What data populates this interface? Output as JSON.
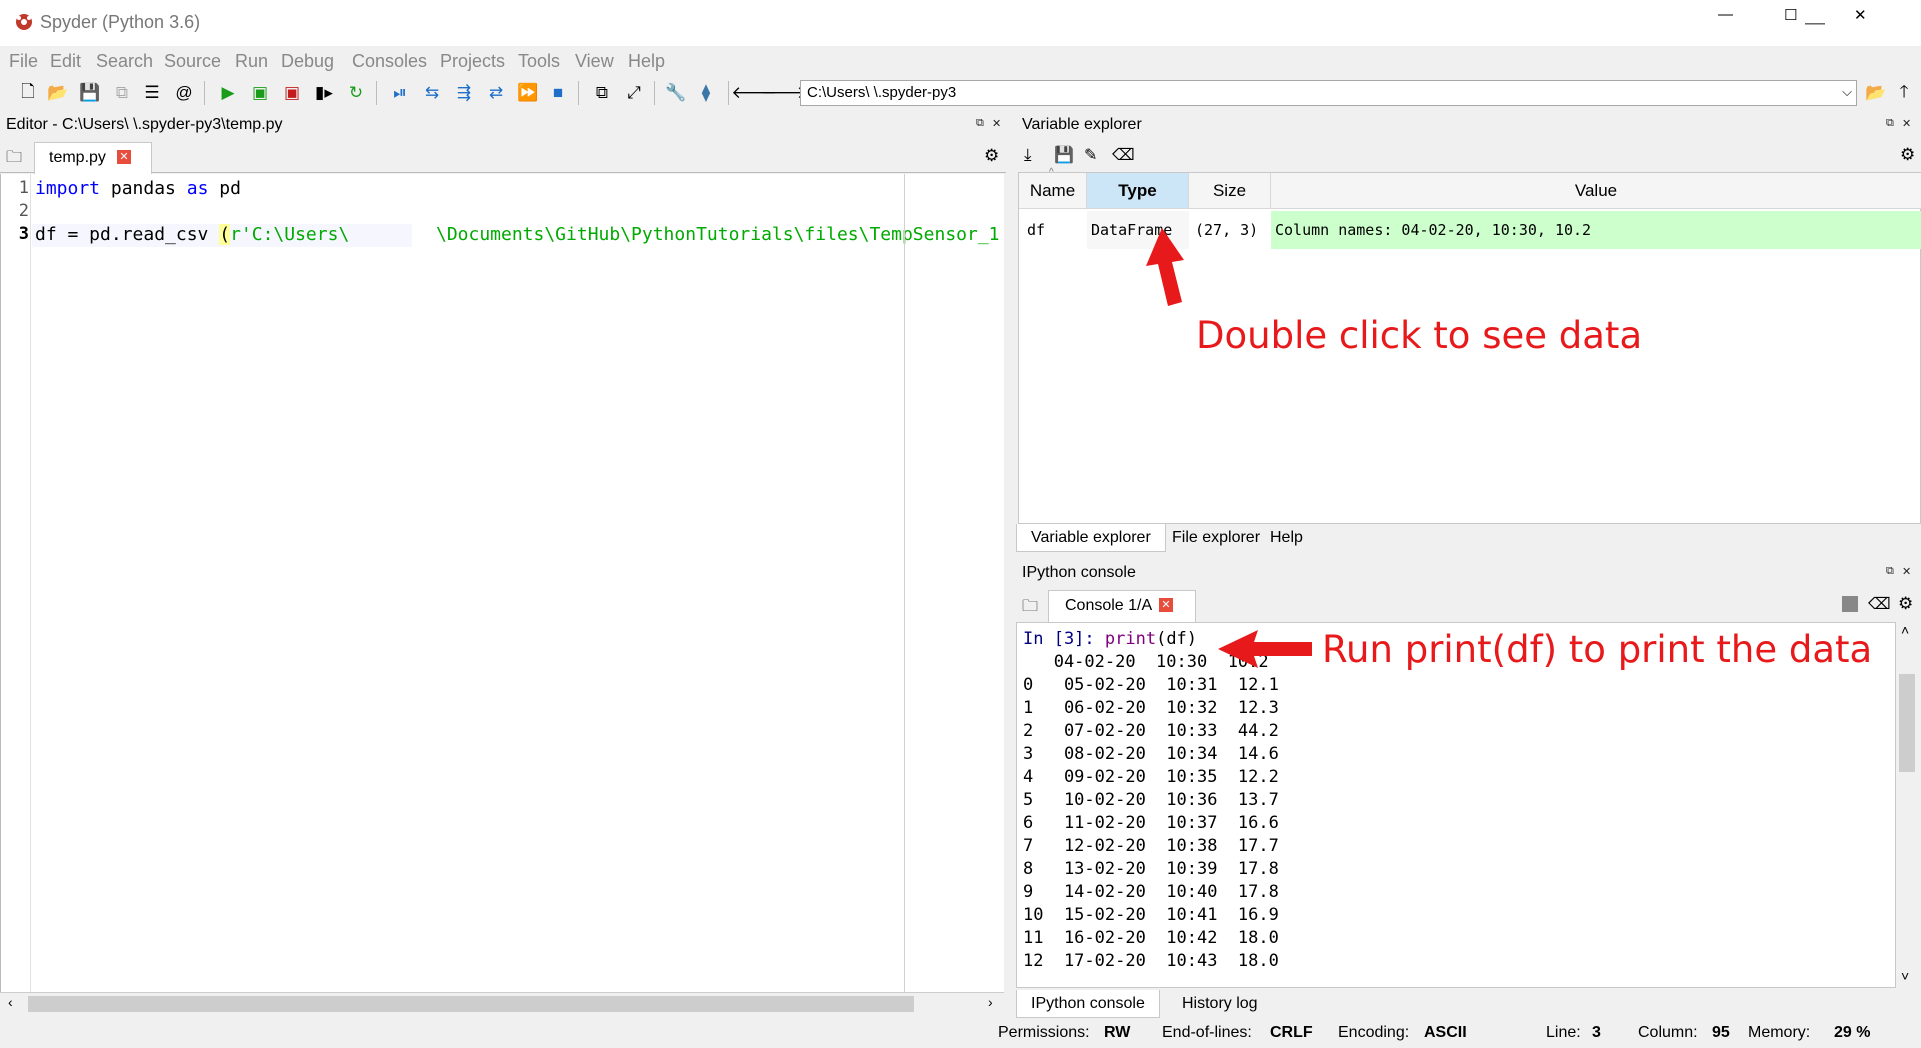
{
  "window": {
    "title": "Spyder (Python 3.6)",
    "minimize": "—",
    "maximize": "☐",
    "close": "✕"
  },
  "menu": [
    "File",
    "Edit",
    "Search",
    "Source",
    "Run",
    "Debug",
    "Consoles",
    "Projects",
    "Tools",
    "View",
    "Help"
  ],
  "toolbar": {
    "path": "C:\\Users\\           \\.spyder-py3"
  },
  "editor": {
    "header": "Editor - C:\\Users\\           \\.spyder-py3\\temp.py",
    "tab": "temp.py",
    "lines": [
      {
        "num": "1",
        "tokens": [
          {
            "t": "import",
            "c": "#0000ff"
          },
          {
            "t": " pandas ",
            "c": "#000000"
          },
          {
            "t": "as",
            "c": "#0000ff"
          },
          {
            "t": " pd",
            "c": "#000000"
          }
        ]
      },
      {
        "num": "2",
        "tokens": []
      },
      {
        "num": "3",
        "tokens": [
          {
            "t": "df = pd.read_csv ",
            "c": "#000000"
          },
          {
            "t": "(",
            "c": "#000000",
            "bg": "#ffff99"
          },
          {
            "t": "r'C:\\Users\\        \\Documents\\GitHub\\PythonTutorials\\files\\TempSensor_1",
            "c": "#00aa00"
          }
        ]
      }
    ]
  },
  "variable_explorer": {
    "header": "Variable explorer",
    "columns": [
      "Name",
      "Type",
      "Size",
      "Value"
    ],
    "rows": [
      {
        "name": "df",
        "type": "DataFrame",
        "size": "(27, 3)",
        "value": "Column names: 04-02-20, 10:30, 10.2"
      }
    ],
    "value_bg": "#ccffcc",
    "tabs": [
      "Variable explorer",
      "File explorer",
      "Help"
    ]
  },
  "console": {
    "header": "IPython console",
    "tab": "Console 1/A",
    "prompt": "In [3]: ",
    "command_fn": "print",
    "command_args": "(df)",
    "output": [
      "   04-02-20  10:30  10.2",
      "0   05-02-20  10:31  12.1",
      "1   06-02-20  10:32  12.3",
      "2   07-02-20  10:33  44.2",
      "3   08-02-20  10:34  14.6",
      "4   09-02-20  10:35  12.2",
      "5   10-02-20  10:36  13.7",
      "6   11-02-20  10:37  16.6",
      "7   12-02-20  10:38  17.7",
      "8   13-02-20  10:39  17.8",
      "9   14-02-20  10:40  17.8",
      "10  15-02-20  10:41  16.9",
      "11  16-02-20  10:42  18.0",
      "12  17-02-20  10:43  18.0"
    ],
    "tabs": [
      "IPython console",
      "History log"
    ]
  },
  "status": {
    "permissions_label": "Permissions:",
    "permissions": "RW",
    "eol_label": "End-of-lines:",
    "eol": "CRLF",
    "encoding_label": "Encoding:",
    "encoding": "ASCII",
    "line_label": "Line:",
    "line": "3",
    "column_label": "Column:",
    "column": "95",
    "memory_label": "Memory:",
    "memory": "29 %"
  },
  "annotations": {
    "double_click": "Double click to see data",
    "run_print": "Run print(df) to print the data",
    "color": "#e8191b"
  }
}
